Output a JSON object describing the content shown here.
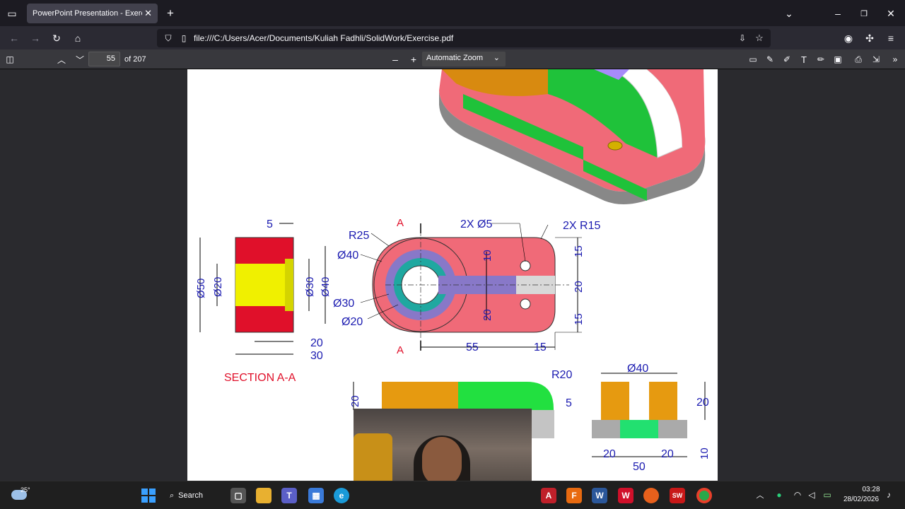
{
  "browser": {
    "tab_title": "PowerPoint Presentation - Exercise.pdf",
    "url": "file:///C:/Users/Acer/Documents/Kuliah Fadhli/SolidWork/Exercise.pdf"
  },
  "pdf_toolbar": {
    "page_number": "55",
    "page_total": "of 207",
    "zoom": "Automatic Zoom"
  },
  "drawing": {
    "labels": {
      "a_top": "A",
      "a_bottom": "A",
      "r25": "R25",
      "d40_left": "Ø40",
      "d30_left": "Ø30",
      "d20_left": "Ø20",
      "holes": "2X Ø5",
      "r15": "2X R15",
      "d10": "10",
      "d20_v": "20",
      "d15_top": "15",
      "d20_right": "20",
      "d15_bottom": "15",
      "d55": "55",
      "d15_h": "15",
      "sec_5": "5",
      "sec_d50": "Ø50",
      "sec_d20": "Ø20",
      "sec_d30": "Ø30",
      "sec_d40": "Ø40",
      "sec_20": "20",
      "sec_30": "30",
      "section_title": "SECTION A-A",
      "r20": "R20",
      "front_20": "20",
      "side_d40": "Ø40",
      "side_5": "5",
      "side_20_right": "20",
      "side_20_left": "20",
      "side_20_mid": "20",
      "side_10": "10",
      "side_50": "50"
    }
  },
  "taskbar": {
    "weather": "25°",
    "search": "Search",
    "time": "03:28",
    "date": "28/02/2026"
  },
  "colors": {
    "dim_blue": "#1a1ab0",
    "section_red": "#e0102a",
    "part_pink": "#f06a78",
    "part_green": "#1fc23a"
  }
}
